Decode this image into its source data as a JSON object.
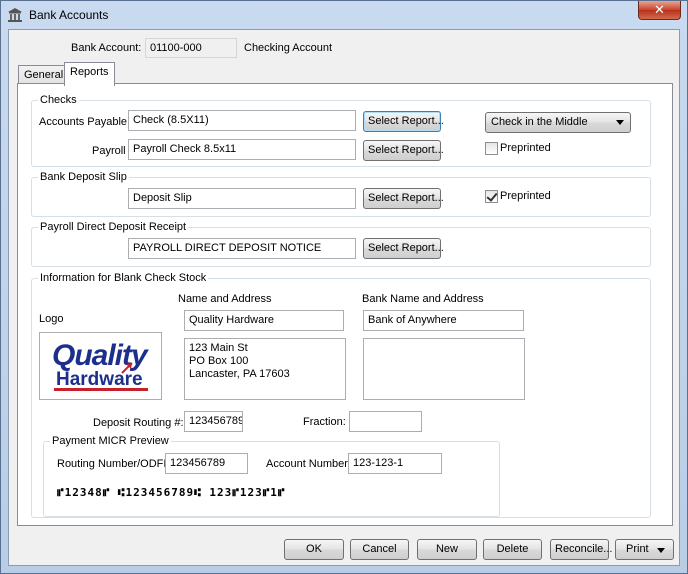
{
  "window": {
    "title": "Bank Accounts",
    "close_glyph": "✕"
  },
  "header": {
    "bank_account_label": "Bank Account:",
    "bank_account_value": "01100-000",
    "bank_account_name": "Checking Account"
  },
  "tabs": [
    {
      "label": "General"
    },
    {
      "label": "Reports"
    }
  ],
  "checks": {
    "group_title": "Checks",
    "accounts_payable_label": "Accounts Payable",
    "accounts_payable_value": "Check (8.5X11)",
    "payroll_label": "Payroll",
    "payroll_value": "Payroll Check 8.5x11",
    "select_report_label": "Select Report...",
    "position_select_value": "Check in the Middle",
    "preprinted_label": "Preprinted",
    "preprinted_checked": false
  },
  "deposit_slip": {
    "group_title": "Bank Deposit Slip",
    "value": "Deposit Slip",
    "select_report_label": "Select Report...",
    "preprinted_label": "Preprinted",
    "preprinted_checked": true
  },
  "direct_deposit": {
    "group_title": "Payroll Direct Deposit Receipt",
    "value": "PAYROLL DIRECT DEPOSIT NOTICE",
    "select_report_label": "Select Report..."
  },
  "blank_stock": {
    "group_title": "Information for Blank Check Stock",
    "logo_label": "Logo",
    "logo_line1": "Quality",
    "logo_line2": "Hardware",
    "name_address_label": "Name and Address",
    "company_name": "Quality Hardware",
    "company_address_lines": [
      "123 Main St",
      "PO Box 100",
      "Lancaster, PA 17603"
    ],
    "bank_name_label": "Bank Name and Address",
    "bank_name": "Bank of Anywhere",
    "deposit_routing_label": "Deposit Routing #:",
    "deposit_routing_value": "123456789",
    "fraction_label": "Fraction:",
    "fraction_value": ""
  },
  "micr": {
    "group_title": "Payment MICR Preview",
    "routing_label": "Routing Number/ODFI:",
    "routing_value": "123456789",
    "account_label": "Account Number:",
    "account_value": "123-123-1",
    "preview_line": "⑈12348⑈  ⑆123456789⑆  123⑈123⑈1⑈"
  },
  "footer": {
    "ok": "OK",
    "cancel": "Cancel",
    "new": "New",
    "delete": "Delete",
    "reconcile": "Reconcile...",
    "print": "Print"
  },
  "colors": {
    "logo_blue": "#1c2f8c",
    "logo_red": "#c8202a",
    "title_close": "#c7432b"
  }
}
